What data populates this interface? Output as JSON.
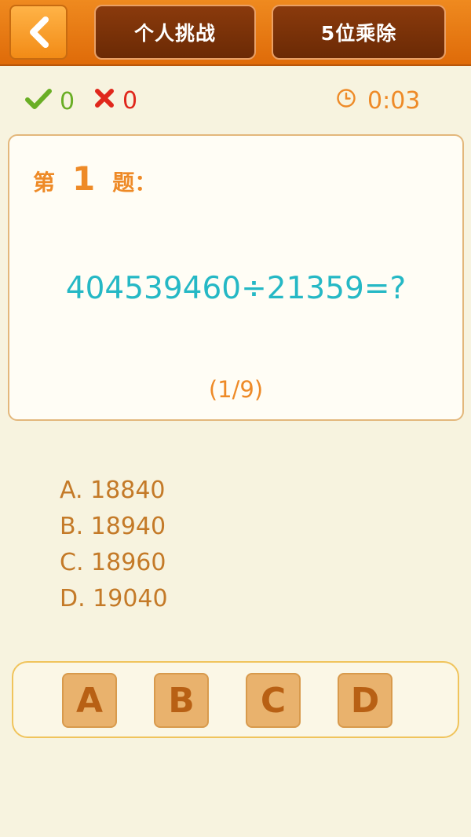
{
  "header": {
    "mode_label": "个人挑战",
    "level_label": "5位乘除"
  },
  "status": {
    "correct_count": "0",
    "wrong_count": "0",
    "timer": "0:03"
  },
  "question": {
    "prefix": "第",
    "number": "1",
    "suffix": "题：",
    "expression": "404539460÷21359=?",
    "progress": "(1/9)"
  },
  "options": [
    {
      "label": "A. 18840"
    },
    {
      "label": "B. 18940"
    },
    {
      "label": "C. 18960"
    },
    {
      "label": "D. 19040"
    }
  ],
  "answer_buttons": [
    {
      "label": "A"
    },
    {
      "label": "B"
    },
    {
      "label": "C"
    },
    {
      "label": "D"
    }
  ],
  "icons": {
    "back": "chevron-left-icon",
    "correct": "check-icon",
    "wrong": "cross-icon",
    "timer": "clock-icon"
  },
  "colors": {
    "accent_orange": "#ee8a27",
    "correct_green": "#6aae25",
    "wrong_red": "#e0271c",
    "expression_teal": "#25b8c5",
    "option_brown": "#c47a28"
  }
}
